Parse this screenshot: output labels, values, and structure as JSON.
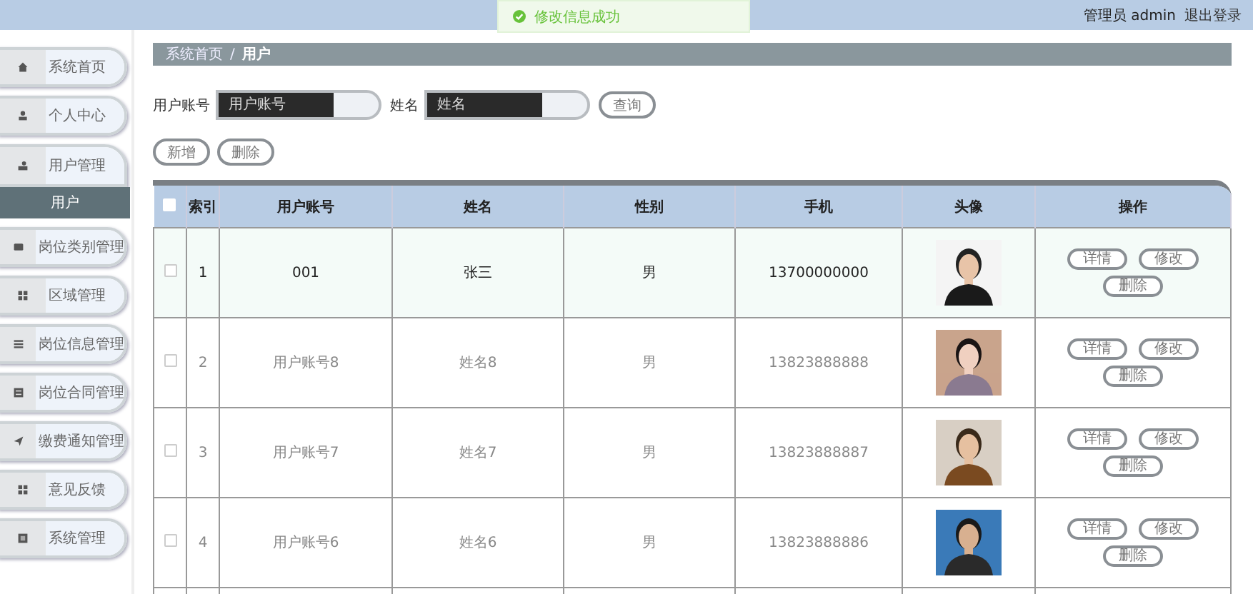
{
  "header": {
    "user_label": "管理员 admin",
    "logout": "退出登录"
  },
  "toast": {
    "message": "修改信息成功"
  },
  "sidebar": {
    "items": [
      {
        "label": "系统首页",
        "expanded": false
      },
      {
        "label": "个人中心",
        "expanded": false
      },
      {
        "label": "用户管理",
        "expanded": true,
        "children": [
          {
            "label": "用户",
            "selected": true
          }
        ]
      },
      {
        "label": "岗位类别管理",
        "expanded": false
      },
      {
        "label": "区域管理",
        "expanded": false
      },
      {
        "label": "岗位信息管理",
        "expanded": false
      },
      {
        "label": "岗位合同管理",
        "expanded": false
      },
      {
        "label": "缴费通知管理",
        "expanded": false
      },
      {
        "label": "意见反馈",
        "expanded": false
      },
      {
        "label": "系统管理",
        "expanded": false
      }
    ]
  },
  "breadcrumb": {
    "items": [
      "系统首页",
      "用户"
    ],
    "separator": "/"
  },
  "search": {
    "fields": [
      {
        "label": "用户账号",
        "placeholder": "用户账号"
      },
      {
        "label": "姓名",
        "placeholder": "姓名"
      }
    ],
    "button": "查询"
  },
  "actions": [
    "新增",
    "删除"
  ],
  "table": {
    "select_all_checked": false,
    "columns": [
      "索引",
      "用户账号",
      "姓名",
      "性别",
      "手机",
      "头像",
      "操作"
    ],
    "rows": [
      {
        "index": "1",
        "account": "001",
        "name": "张三",
        "gender": "男",
        "phone": "13700000000",
        "highlighted": true,
        "checked": false,
        "actions": [
          "详情",
          "修改",
          "删除"
        ]
      },
      {
        "index": "2",
        "account": "用户账号8",
        "name": "姓名8",
        "gender": "男",
        "phone": "13823888888",
        "highlighted": false,
        "checked": false,
        "actions": [
          "详情",
          "修改",
          "删除"
        ]
      },
      {
        "index": "3",
        "account": "用户账号7",
        "name": "姓名7",
        "gender": "男",
        "phone": "13823888887",
        "highlighted": false,
        "checked": false,
        "actions": [
          "详情",
          "修改",
          "删除"
        ]
      },
      {
        "index": "4",
        "account": "用户账号6",
        "name": "姓名6",
        "gender": "男",
        "phone": "13823888886",
        "highlighted": false,
        "checked": false,
        "actions": [
          "详情",
          "修改",
          "删除"
        ]
      }
    ]
  }
}
